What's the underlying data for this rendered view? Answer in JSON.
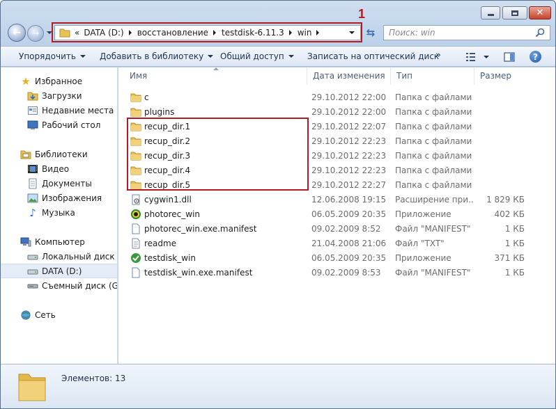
{
  "address": {
    "overflow": "«",
    "crumbs": [
      "DATA (D:)",
      "восстановление",
      "testdisk-6.11.3",
      "win"
    ]
  },
  "annotation_marker": "1",
  "search": {
    "placeholder": "Поиск: win"
  },
  "toolbar": {
    "organize": "Упорядочить",
    "add_library": "Добавить в библиотеку",
    "share": "Общий доступ",
    "burn": "Записать на оптический диск",
    "more": "»"
  },
  "nav": {
    "favorites": "Избранное",
    "downloads": "Загрузки",
    "recent": "Недавние места",
    "desktop": "Рабочий стол",
    "libraries": "Библиотеки",
    "video": "Видео",
    "documents": "Документы",
    "pictures": "Изображения",
    "music": "Музыка",
    "computer": "Компьютер",
    "local_disk": "Локальный диск (C",
    "data_disk": "DATA (D:)",
    "removable": "Съемный диск (G:)",
    "network": "Сеть"
  },
  "columns": {
    "name": "Имя",
    "date": "Дата изменения",
    "type": "Тип",
    "size": "Размер"
  },
  "files": [
    {
      "name": "c",
      "date": "29.10.2012 22:00",
      "type": "Папка с файлами",
      "size": "",
      "icon": "folder"
    },
    {
      "name": "plugins",
      "date": "29.10.2012 22:00",
      "type": "Папка с файлами",
      "size": "",
      "icon": "folder"
    },
    {
      "name": "recup_dir.1",
      "date": "29.10.2012 22:07",
      "type": "Папка с файлами",
      "size": "",
      "icon": "folder"
    },
    {
      "name": "recup_dir.2",
      "date": "29.10.2012 22:23",
      "type": "Папка с файлами",
      "size": "",
      "icon": "folder"
    },
    {
      "name": "recup_dir.3",
      "date": "29.10.2012 22:23",
      "type": "Папка с файлами",
      "size": "",
      "icon": "folder"
    },
    {
      "name": "recup_dir.4",
      "date": "29.10.2012 22:23",
      "type": "Папка с файлами",
      "size": "",
      "icon": "folder"
    },
    {
      "name": "recup_dir.5",
      "date": "29.10.2012 22:27",
      "type": "Папка с файлами",
      "size": "",
      "icon": "folder"
    },
    {
      "name": "cygwin1.dll",
      "date": "12.06.2008 19:15",
      "type": "Расширение при...",
      "size": "1 829 КБ",
      "icon": "dll"
    },
    {
      "name": "photorec_win",
      "date": "06.05.2009 20:35",
      "type": "Приложение",
      "size": "402 КБ",
      "icon": "photorec"
    },
    {
      "name": "photorec_win.exe.manifest",
      "date": "09.02.2009 8:52",
      "type": "Файл \"MANIFEST\"",
      "size": "1 КБ",
      "icon": "file"
    },
    {
      "name": "readme",
      "date": "21.04.2008 21:06",
      "type": "Файл \"TXT\"",
      "size": "1 КБ",
      "icon": "text"
    },
    {
      "name": "testdisk_win",
      "date": "06.05.2009 20:35",
      "type": "Приложение",
      "size": "371 КБ",
      "icon": "testdisk"
    },
    {
      "name": "testdisk_win.exe.manifest",
      "date": "09.02.2009 8:53",
      "type": "Файл \"MANIFEST\"",
      "size": "1 КБ",
      "icon": "file"
    }
  ],
  "status": {
    "count": "Элементов: 13"
  },
  "colors": {
    "highlight_box": "#b31b22",
    "folder": "#e8c257"
  }
}
